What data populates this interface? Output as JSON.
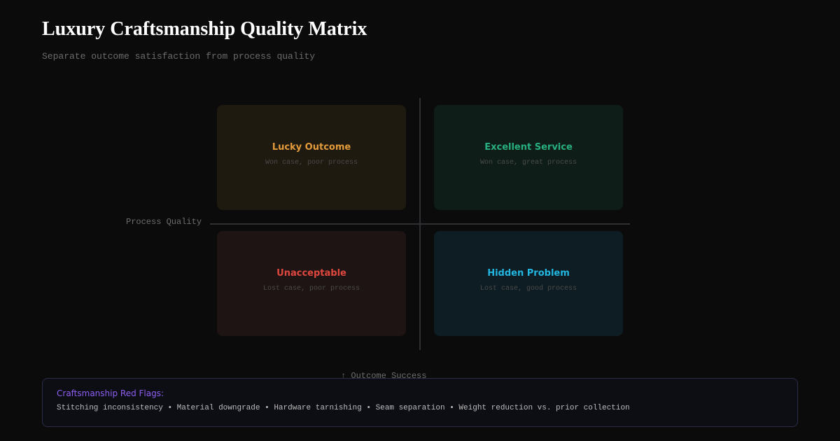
{
  "header": {
    "title": "Luxury Craftsmanship Quality Matrix",
    "subtitle": "Separate outcome satisfaction from process quality"
  },
  "matrix": {
    "y_axis_label": "Process Quality",
    "x_axis_label": "↑ Outcome Success",
    "quadrants": [
      {
        "title": "Lucky Outcome",
        "description": "Won case, poor process",
        "color": "#e39a3a"
      },
      {
        "title": "Excellent Service",
        "description": "Won case, great process",
        "color": "#27b07f"
      },
      {
        "title": "Unacceptable",
        "description": "Lost case, poor process",
        "color": "#e0473f"
      },
      {
        "title": "Hidden Problem",
        "description": "Lost case, good process",
        "color": "#22b5e0"
      }
    ]
  },
  "legend": {
    "title": "Craftsmanship Red Flags:",
    "title_color": "#8e5ff0",
    "separator": "•",
    "items": [
      "Stitching inconsistency",
      "Material downgrade",
      "Hardware tarnishing",
      "Seam separation",
      "Weight reduction vs. prior collection"
    ]
  }
}
